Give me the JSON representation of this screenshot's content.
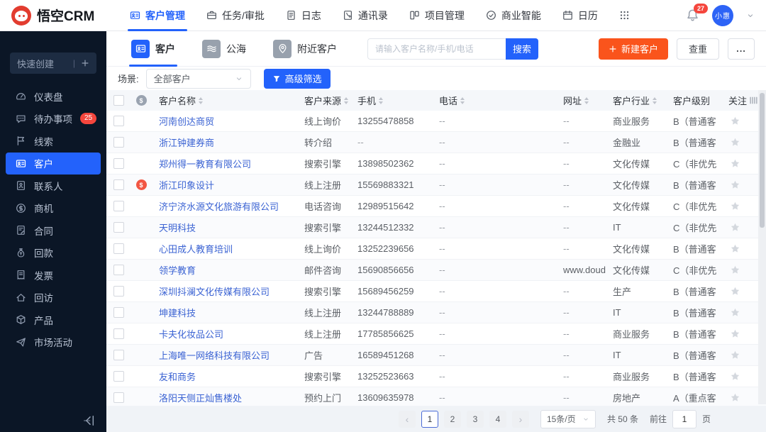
{
  "colors": {
    "accent": "#2362fb",
    "orange": "#fa541c",
    "sidebar_bg": "#0b1626",
    "badge_red": "#f5463d"
  },
  "navbar": {
    "brand": "悟空CRM",
    "items": [
      {
        "key": "customer-mgmt",
        "label": "客户管理",
        "icon": "idcard",
        "active": true
      },
      {
        "key": "task-approval",
        "label": "任务/审批",
        "icon": "briefcase",
        "active": false
      },
      {
        "key": "log",
        "label": "日志",
        "icon": "doc",
        "active": false
      },
      {
        "key": "address-book",
        "label": "通讯录",
        "icon": "phonebook",
        "active": false
      },
      {
        "key": "project-mgmt",
        "label": "项目管理",
        "icon": "kanban",
        "active": false
      },
      {
        "key": "business-intelligence",
        "label": "商业智能",
        "icon": "bi",
        "active": false
      },
      {
        "key": "calendar",
        "label": "日历",
        "icon": "calendar",
        "active": false
      }
    ],
    "notification_count": "27",
    "avatar_name": "小惠"
  },
  "sidebar": {
    "quick_create": "快速创建",
    "items": [
      {
        "key": "dashboard",
        "label": "仪表盘",
        "icon": "gauge"
      },
      {
        "key": "todo",
        "label": "待办事项",
        "icon": "chat",
        "badge": "25"
      },
      {
        "key": "leads",
        "label": "线索",
        "icon": "flag"
      },
      {
        "key": "customer",
        "label": "客户",
        "icon": "idcard",
        "active": true
      },
      {
        "key": "contacts",
        "label": "联系人",
        "icon": "contact"
      },
      {
        "key": "opportunity",
        "label": "商机",
        "icon": "coin"
      },
      {
        "key": "contract",
        "label": "合同",
        "icon": "contract"
      },
      {
        "key": "receivables",
        "label": "回款",
        "icon": "moneybag"
      },
      {
        "key": "invoice",
        "label": "发票",
        "icon": "invoice"
      },
      {
        "key": "visit",
        "label": "回访",
        "icon": "home"
      },
      {
        "key": "product",
        "label": "产品",
        "icon": "box"
      },
      {
        "key": "campaign",
        "label": "市场活动",
        "icon": "plane"
      }
    ]
  },
  "toolbar": {
    "tabs": [
      {
        "key": "customer",
        "label": "客户",
        "icon": "idcard",
        "active": true
      },
      {
        "key": "public-sea",
        "label": "公海",
        "icon": "waves",
        "active": false
      },
      {
        "key": "nearby-customer",
        "label": "附近客户",
        "icon": "pin",
        "active": false
      }
    ],
    "search_placeholder": "请输入客户名称/手机/电话",
    "search_button": "搜索",
    "new_customer_button": "新建客户",
    "dedupe_button": "查重",
    "more_button": "..."
  },
  "scene": {
    "label": "场景:",
    "value": "全部客户",
    "filter_button": "高级筛选"
  },
  "table": {
    "headers": [
      {
        "label": "客户名称",
        "sortable": true
      },
      {
        "label": "客户来源",
        "sortable": true
      },
      {
        "label": "手机",
        "sortable": true
      },
      {
        "label": "电话",
        "sortable": true
      },
      {
        "label": "网址",
        "sortable": true
      },
      {
        "label": "客户行业",
        "sortable": true
      },
      {
        "label": "客户级别",
        "sortable": false
      },
      {
        "label": "关注",
        "sortable": false
      }
    ],
    "rows": [
      {
        "name": "河南创达商贸",
        "deal": false,
        "source": "线上询价",
        "mobile": "13255478858",
        "phone": "--",
        "website": "--",
        "industry": "商业服务",
        "level": "B（普通客"
      },
      {
        "name": "浙江钟建券商",
        "deal": false,
        "source": "转介绍",
        "mobile": "--",
        "phone": "--",
        "website": "--",
        "industry": "金融业",
        "level": "B（普通客"
      },
      {
        "name": "郑州得一教育有限公司",
        "deal": false,
        "source": "搜索引擎",
        "mobile": "13898502362",
        "phone": "--",
        "website": "--",
        "industry": "文化传媒",
        "level": "C（非优先"
      },
      {
        "name": "浙江印象设计",
        "deal": true,
        "source": "线上注册",
        "mobile": "15569883321",
        "phone": "--",
        "website": "--",
        "industry": "文化传媒",
        "level": "B（普通客"
      },
      {
        "name": "济宁济水源文化旅游有限公司",
        "deal": false,
        "source": "电话咨询",
        "mobile": "12989515642",
        "phone": "--",
        "website": "--",
        "industry": "文化传媒",
        "level": "C（非优先"
      },
      {
        "name": "天明科技",
        "deal": false,
        "source": "搜索引擎",
        "mobile": "13244512332",
        "phone": "--",
        "website": "--",
        "industry": "IT",
        "level": "C（非优先"
      },
      {
        "name": "心田成人教育培训",
        "deal": false,
        "source": "线上询价",
        "mobile": "13252239656",
        "phone": "--",
        "website": "--",
        "industry": "文化传媒",
        "level": "B（普通客"
      },
      {
        "name": "领学教育",
        "deal": false,
        "source": "邮件咨询",
        "mobile": "15690856656",
        "phone": "--",
        "website": "www.doud...",
        "industry": "文化传媒",
        "level": "C（非优先"
      },
      {
        "name": "深圳抖澜文化传媒有限公司",
        "deal": false,
        "source": "搜索引擎",
        "mobile": "15689456259",
        "phone": "--",
        "website": "--",
        "industry": "生产",
        "level": "B（普通客"
      },
      {
        "name": "坤建科技",
        "deal": false,
        "source": "线上注册",
        "mobile": "13244788889",
        "phone": "--",
        "website": "--",
        "industry": "IT",
        "level": "B（普通客"
      },
      {
        "name": "卡夫化妆品公司",
        "deal": false,
        "source": "线上注册",
        "mobile": "17785856625",
        "phone": "--",
        "website": "--",
        "industry": "商业服务",
        "level": "B（普通客"
      },
      {
        "name": "上海唯一网络科技有限公司",
        "deal": false,
        "source": "广告",
        "mobile": "16589451268",
        "phone": "--",
        "website": "--",
        "industry": "IT",
        "level": "B（普通客"
      },
      {
        "name": "友和商务",
        "deal": false,
        "source": "搜索引擎",
        "mobile": "13252523663",
        "phone": "--",
        "website": "--",
        "industry": "商业服务",
        "level": "B（普通客"
      },
      {
        "name": "洛阳天侧正灿售楼处",
        "deal": false,
        "source": "预约上门",
        "mobile": "13609635978",
        "phone": "--",
        "website": "--",
        "industry": "房地产",
        "level": "A（重点客"
      }
    ]
  },
  "pagination": {
    "prev": "‹",
    "next": "›",
    "pages": [
      "1",
      "2",
      "3",
      "4"
    ],
    "active_page": "1",
    "page_size": "15条/页",
    "total": "共 50 条",
    "goto_label": "前往",
    "goto_value": "1",
    "unit_label": "页"
  }
}
